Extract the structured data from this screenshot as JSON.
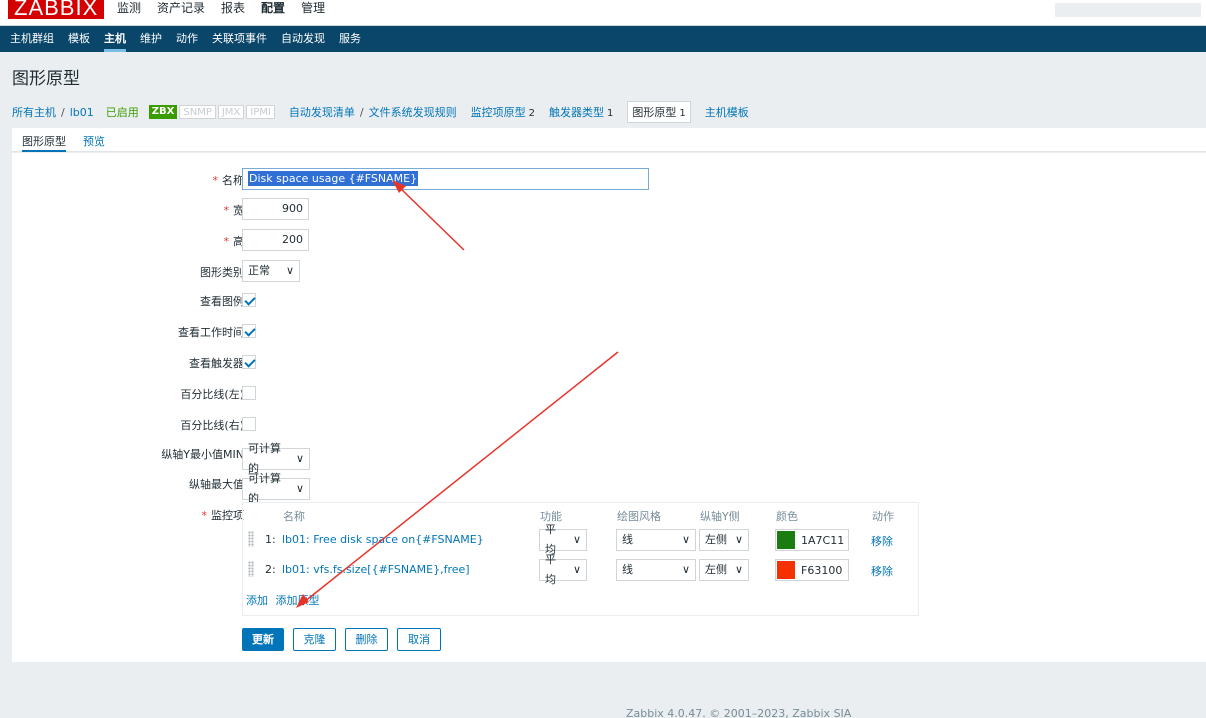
{
  "topbar": {
    "logo": "ZABBIX",
    "menu": [
      "监测",
      "资产记录",
      "报表",
      "配置",
      "管理"
    ],
    "active": "配置"
  },
  "submenu": {
    "items": [
      "主机群组",
      "模板",
      "主机",
      "维护",
      "动作",
      "关联项事件",
      "自动发现",
      "服务"
    ],
    "active": "主机"
  },
  "page_title": "图形原型",
  "breadcrumb": {
    "all_hosts": "所有主机",
    "separator": "/",
    "host": "lb01",
    "status": "已启用",
    "badges": [
      "ZBX",
      "SNMP",
      "JMX",
      "IPMI"
    ],
    "discovery_list": "自动发现清单",
    "discovery_rule": "文件系统发现规则",
    "item_prototypes": "监控项原型",
    "item_prototypes_count": "2",
    "trigger_prototypes": "触发器类型",
    "trigger_prototypes_count": "1",
    "graph_prototypes": "图形原型",
    "graph_prototypes_count": "1",
    "host_prototypes": "主机模板"
  },
  "tabs": [
    "图形原型",
    "预览"
  ],
  "form": {
    "name_label": "名称",
    "name_value": "Disk space usage {#FSNAME}",
    "width_label": "宽",
    "width_value": "900",
    "height_label": "高",
    "height_value": "200",
    "graph_type_label": "图形类别",
    "graph_type_value": "正常",
    "show_legend_label": "查看图例",
    "show_working_time_label": "查看工作时间",
    "show_triggers_label": "查看触发器",
    "percentile_left_label": "百分比线(左)",
    "percentile_right_label": "百分比线(右)",
    "ymin_label": "纵轴Y最小值MIN",
    "ymin_value": "可计算的",
    "ymax_label": "纵轴最大值",
    "ymax_value": "可计算的",
    "items_label": "监控项",
    "checks": {
      "legend": true,
      "working_time": true,
      "triggers": true,
      "percentile_left": false,
      "percentile_right": false
    }
  },
  "items_table": {
    "headers": {
      "name": "名称",
      "function": "功能",
      "draw_style": "绘图风格",
      "y_axis_side": "纵轴Y侧",
      "color": "颜色",
      "action": "动作"
    },
    "rows": [
      {
        "num": "1:",
        "name": "lb01: Free disk space on{#FSNAME}",
        "function": "平均",
        "draw_style": "线",
        "y_axis": "左侧",
        "color": "1A7C11",
        "swatch": "#1a7c11",
        "action": "移除"
      },
      {
        "num": "2:",
        "name": "lb01: vfs.fs.size[{#FSNAME},free]",
        "function": "平均",
        "draw_style": "线",
        "y_axis": "左侧",
        "color": "F63100",
        "swatch": "#f63100",
        "action": "移除"
      }
    ],
    "add": "添加",
    "add_prototype": "添加原型"
  },
  "buttons": {
    "update": "更新",
    "clone": "克隆",
    "delete": "删除",
    "cancel": "取消"
  },
  "footer": "Zabbix 4.0.47. © 2001–2023, Zabbix SIA",
  "colors": {
    "header_blue": "#0a466a",
    "logo_red": "#d40000",
    "link": "#0275b8",
    "enabled_green": "#3b9c00",
    "arrow_red": "#e8332a"
  }
}
